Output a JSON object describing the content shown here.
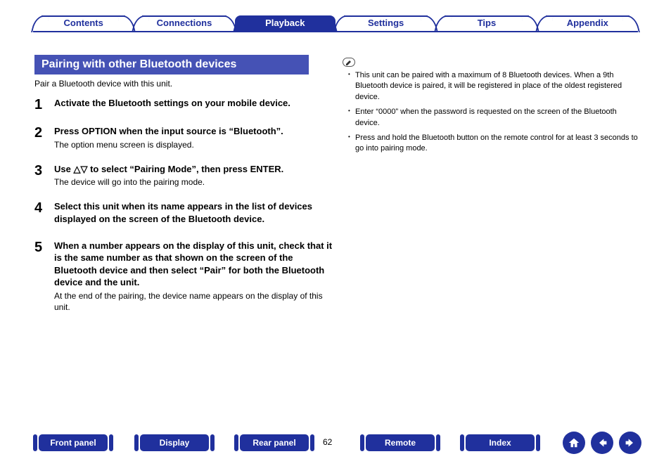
{
  "tabs": [
    "Contents",
    "Connections",
    "Playback",
    "Settings",
    "Tips",
    "Appendix"
  ],
  "active_tab_index": 2,
  "section_title": "Pairing with other Bluetooth devices",
  "intro": "Pair a Bluetooth device with this unit.",
  "steps": [
    {
      "n": "1",
      "title": "Activate the Bluetooth settings on your mobile device.",
      "sub": ""
    },
    {
      "n": "2",
      "title": "Press OPTION when the input source is “Bluetooth”.",
      "sub": "The option menu screen is displayed."
    },
    {
      "n": "3",
      "title": "Use △▽ to select “Pairing Mode”, then press ENTER.",
      "sub": "The device will go into the pairing mode."
    },
    {
      "n": "4",
      "title": "Select this unit when its name appears in the list of devices displayed on the screen of the Bluetooth device.",
      "sub": ""
    },
    {
      "n": "5",
      "title": "When a number appears on the display of this unit, check that it is the same number as that shown on the screen of the Bluetooth device and then select “Pair” for both the Bluetooth device and the unit.",
      "sub": "At the end of the pairing, the device name appears on the display of this unit."
    }
  ],
  "notes": [
    "This unit can be paired with a maximum of 8 Bluetooth devices. When a 9th Bluetooth device is paired, it will be registered in place of the oldest registered device.",
    "Enter “0000” when the password is requested on the screen of the Bluetooth device.",
    "Press and hold the Bluetooth button on the remote control for at least 3 seconds to go into pairing mode."
  ],
  "bottom_buttons": [
    "Front panel",
    "Display",
    "Rear panel",
    "Remote",
    "Index"
  ],
  "page_number": "62",
  "nav_icons": [
    "home-icon",
    "prev-icon",
    "next-icon"
  ]
}
